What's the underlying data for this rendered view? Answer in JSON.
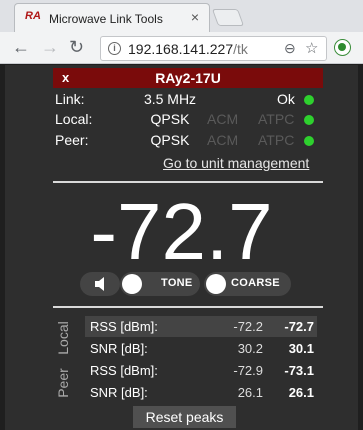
{
  "browser": {
    "tab_logo": "RA",
    "tab_title": "Microwave Link Tools",
    "tab_close": "×",
    "url_host": "192.168.141.227",
    "url_path": "/tk",
    "info_glyph": "i",
    "zoom_glyph": "⊖",
    "star_glyph": "☆",
    "back_glyph": "←",
    "forward_glyph": "→",
    "reload_glyph": "↻"
  },
  "unit": {
    "close_label": "x",
    "name": "RAy2-17U"
  },
  "status": {
    "link_label": "Link:",
    "link_value": "3.5 MHz",
    "link_state": "Ok",
    "local_label": "Local:",
    "local_mod": "QPSK",
    "local_acm": "ACM",
    "local_atpc": "ATPC",
    "peer_label": "Peer:",
    "peer_mod": "QPSK",
    "peer_acm": "ACM",
    "peer_atpc": "ATPC",
    "ok_color": "#2ed12e"
  },
  "goto_link": "Go to unit management",
  "big_value": "-72.7",
  "controls": {
    "speaker_icon": "speaker-icon",
    "tone_label": "TONE",
    "coarse_label": "COARSE"
  },
  "table": {
    "local_label": "Local",
    "peer_label": "Peer",
    "rows": [
      {
        "name": "RSS [dBm]:",
        "peak": "-72.2",
        "current": "-72.7"
      },
      {
        "name": "SNR [dB]:",
        "peak": "30.2",
        "current": "30.1"
      },
      {
        "name": "RSS [dBm]:",
        "peak": "-72.9",
        "current": "-73.1"
      },
      {
        "name": "SNR [dB]:",
        "peak": "26.1",
        "current": "26.1"
      }
    ]
  },
  "reset_label": "Reset peaks",
  "colors": {
    "accent": "#7a0b0b",
    "background": "#2e2e2e"
  }
}
